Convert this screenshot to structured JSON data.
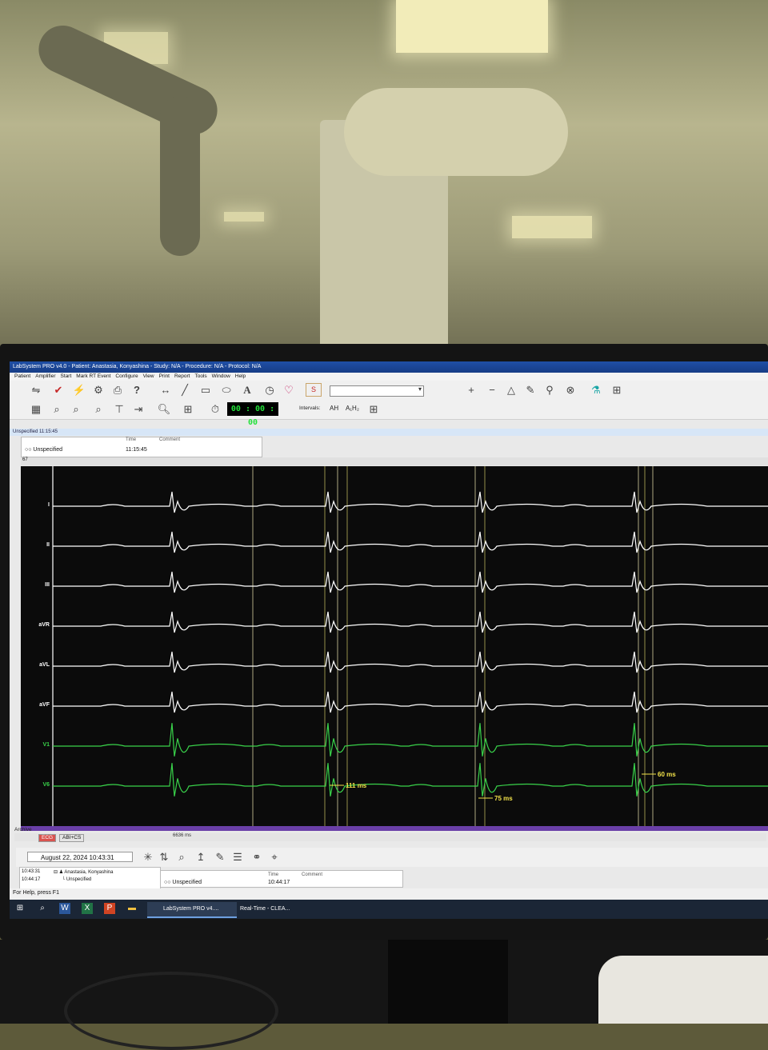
{
  "window": {
    "title": "LabSystem PRO v4.0 - Patient: Anastasia, Konyashina - Study: N/A - Procedure: N/A - Protocol: N/A"
  },
  "menu": [
    "Patient",
    "Amplifier",
    "Start",
    "Mark RT Event",
    "Configure",
    "View",
    "Print",
    "Report",
    "Tools",
    "Window",
    "Help"
  ],
  "toolbar": {
    "timer": "00 : 00 : 00",
    "intervals_label": "Intervals:",
    "interval_ah": "AH",
    "interval_a1h1": "A₁H₂",
    "help_glyph": "?",
    "text_tool_glyph": "A",
    "stim_glyph": "S"
  },
  "eventbar": {
    "text": "Unspecified  11:15:45"
  },
  "event_table": {
    "col_time": "Time",
    "col_comment": "Comment",
    "row_name": "Unspecified",
    "row_time": "11:15:45"
  },
  "scroll_value": "67",
  "leads": [
    {
      "name": "I",
      "color": "#ffffff"
    },
    {
      "name": "II",
      "color": "#ffffff"
    },
    {
      "name": "III",
      "color": "#ffffff"
    },
    {
      "name": "aVR",
      "color": "#ffffff"
    },
    {
      "name": "aVL",
      "color": "#ffffff"
    },
    {
      "name": "aVF",
      "color": "#ffffff"
    },
    {
      "name": "V1",
      "color": "#39d24a"
    },
    {
      "name": "V6",
      "color": "#39d24a"
    }
  ],
  "measurements": [
    "111 ms",
    "75 ms",
    "60 ms"
  ],
  "archive_label": "Archive",
  "tabs": {
    "ecg": "ECG",
    "abi": "ABI+CS"
  },
  "ms_readout": "6636 ms",
  "bottom": {
    "date": "August 22, 2024  10:43:31",
    "tree_time1": "10:43:31",
    "tree_time2": "10:44:17",
    "tree_patient": "Anastasia, Konyashina",
    "tree_event": "Unspecified",
    "col_time": "Time",
    "col_comment": "Comment",
    "row_name": "Unspecified",
    "row_time": "10:44:17"
  },
  "status": "For Help, press F1",
  "taskbar": {
    "app1": "LabSystem PRO v4....",
    "app2": "Real-Time - CLEA..."
  }
}
